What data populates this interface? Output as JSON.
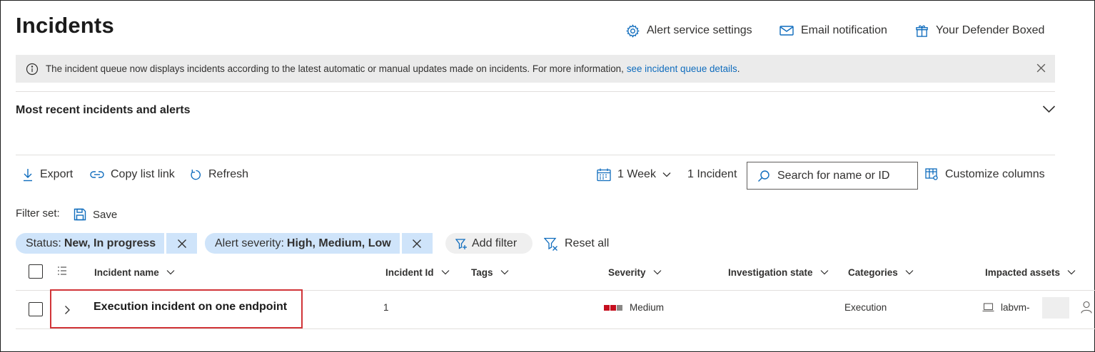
{
  "page": {
    "title": "Incidents"
  },
  "top_actions": [
    {
      "label": "Alert service settings",
      "icon": "gear-icon"
    },
    {
      "label": "Email notification",
      "icon": "mail-icon"
    },
    {
      "label": "Your Defender Boxed",
      "icon": "gift-icon"
    }
  ],
  "banner": {
    "message": "The incident queue now displays incidents according to the latest automatic or manual updates made on incidents. For more information, ",
    "link": "see incident queue details",
    "suffix": "."
  },
  "recent_section": {
    "title": "Most recent incidents and alerts"
  },
  "toolbar": {
    "export": "Export",
    "copy_link": "Copy list link",
    "refresh": "Refresh",
    "time_range": "1 Week",
    "count": "1 Incident",
    "search_placeholder": "Search for name or ID",
    "customize": "Customize columns"
  },
  "filters": {
    "label": "Filter set:",
    "save": "Save",
    "chips": [
      {
        "key": "Status:",
        "value": "New, In progress"
      },
      {
        "key": "Alert severity:",
        "value": "High, Medium, Low"
      }
    ],
    "add_filter": "Add filter",
    "reset_all": "Reset all"
  },
  "table": {
    "columns": [
      "Incident name",
      "Incident Id",
      "Tags",
      "Severity",
      "Investigation state",
      "Categories",
      "Impacted assets"
    ],
    "rows": [
      {
        "name": "Execution incident on one endpoint",
        "id": "1",
        "tags": "",
        "severity": "Medium",
        "investigation_state": "",
        "category": "Execution",
        "asset": "labvm-"
      }
    ]
  },
  "colors": {
    "severity_high": "#c50f1f",
    "severity_inactive": "#8a8886",
    "chip_bg": "#cfe4fa",
    "link": "#0f6cbd",
    "highlight_box": "#d13438",
    "icon_blue": "#0f6cbd"
  }
}
